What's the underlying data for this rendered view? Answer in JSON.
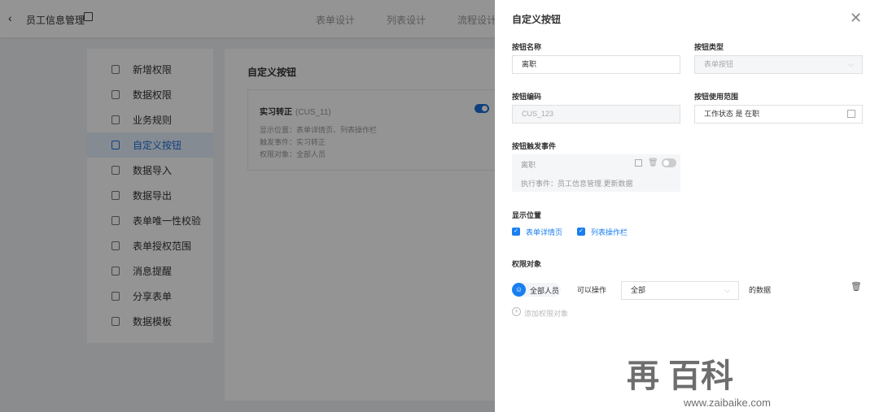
{
  "header": {
    "back": "‹",
    "title": "员工信息管理",
    "tabs": [
      "表单设计",
      "列表设计",
      "流程设计"
    ]
  },
  "sidebar": {
    "items": [
      {
        "label": "新增权限"
      },
      {
        "label": "数据权限"
      },
      {
        "label": "业务规则"
      },
      {
        "label": "自定义按钮",
        "active": true
      },
      {
        "label": "数据导入"
      },
      {
        "label": "数据导出"
      },
      {
        "label": "表单唯一性校验"
      },
      {
        "label": "表单授权范围"
      },
      {
        "label": "消息提醒"
      },
      {
        "label": "分享表单"
      },
      {
        "label": "数据模板"
      }
    ]
  },
  "main": {
    "title": "自定义按钮",
    "card": {
      "name": "实习转正",
      "code": "(CUS_11)",
      "enabled": true,
      "lines": [
        "显示位置：表单详情页、列表操作栏",
        "触发事件：实习转正",
        "权限对象：全部人员"
      ]
    }
  },
  "drawer": {
    "title": "自定义按钮",
    "close": "✕",
    "name_label": "按钮名称",
    "name_value": "离职",
    "type_label": "按钮类型",
    "type_value": "表单按钮",
    "code_label": "按钮编码",
    "code_value": "CUS_123",
    "scope_label": "按钮使用范围",
    "scope_value": "工作状态 是 在职",
    "event_label": "按钮触发事件",
    "event_name": "离职",
    "event_desc": "执行事件：员工信息管理.更新数据",
    "event_enabled": false,
    "position_label": "显示位置",
    "positions": [
      {
        "label": "表单详情页",
        "checked": true
      },
      {
        "label": "列表操作栏",
        "checked": true
      }
    ],
    "perm_label": "权限对象",
    "perm_who": "全部人员",
    "perm_can": "可以操作",
    "perm_select": "全部",
    "perm_suffix": "的数据",
    "add_perm": "添加权限对象"
  },
  "watermark": {
    "text": "再 百科",
    "url": "www.zaibaike.com"
  },
  "colors": {
    "accent": "#1a7ff0"
  }
}
